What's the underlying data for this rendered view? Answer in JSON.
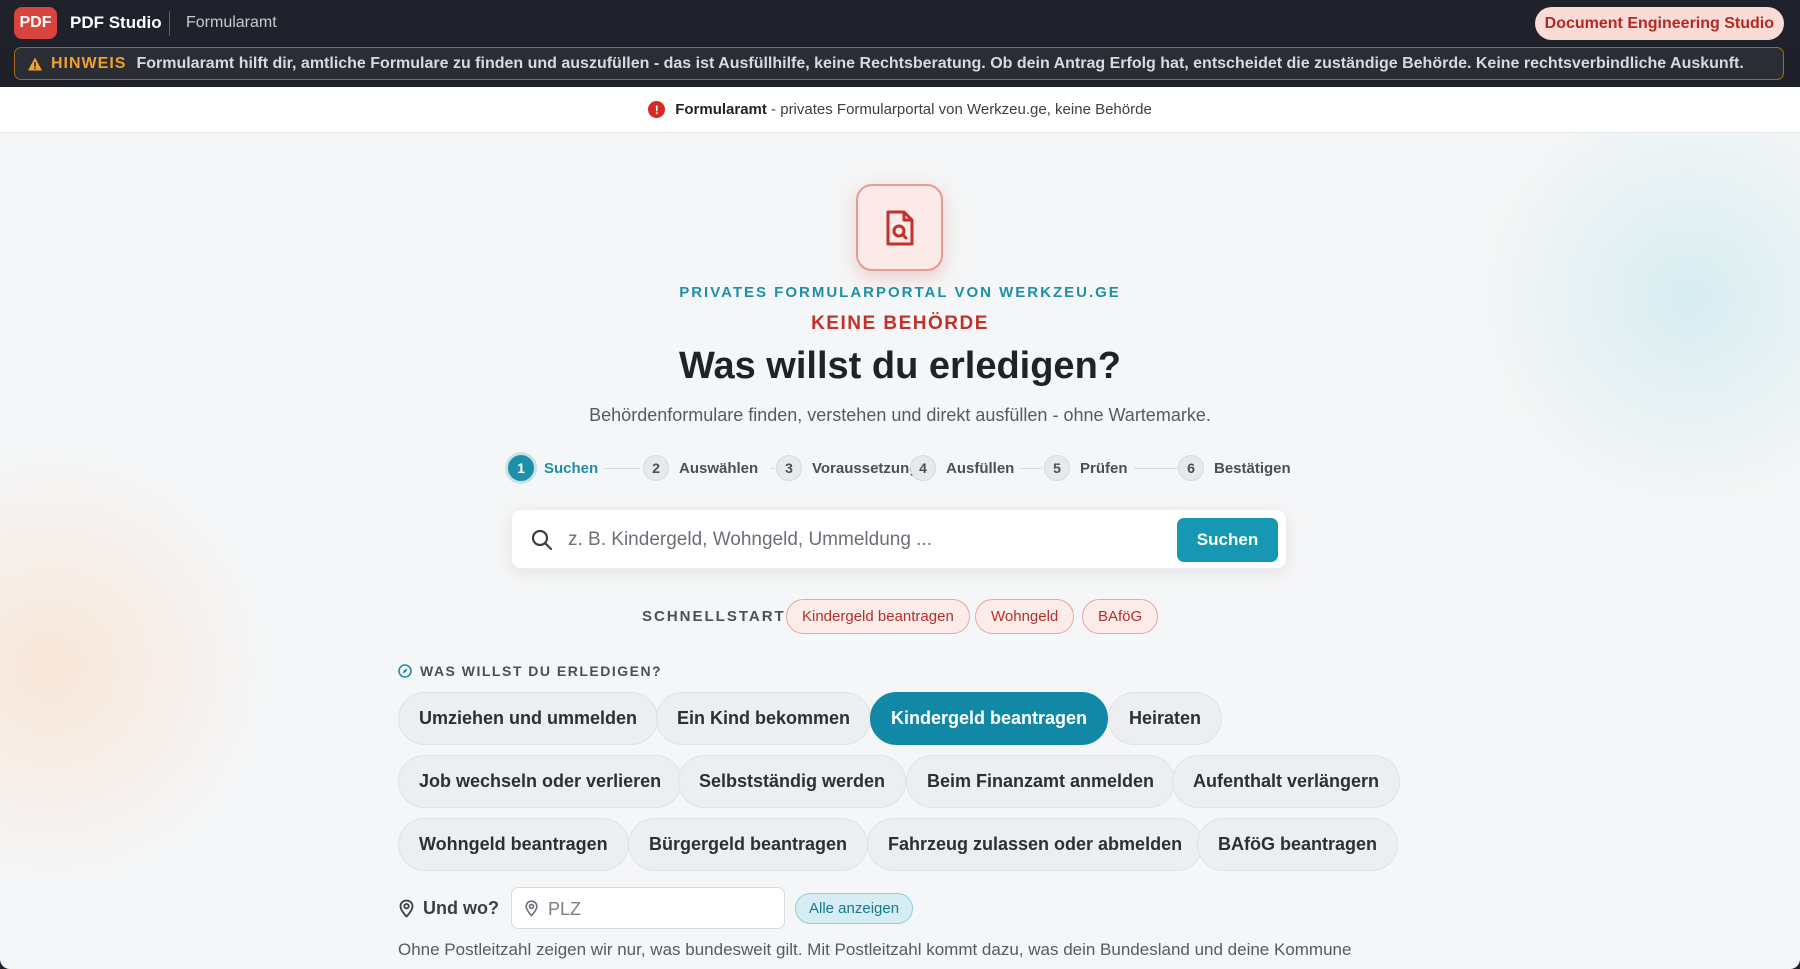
{
  "topbar": {
    "logo": "PDF",
    "app_name": "PDF Studio",
    "breadcrumb": "Formularamt",
    "brand_pill": "Document Engineering Studio"
  },
  "notice": {
    "label": "HINWEIS",
    "text": "Formularamt hilft dir, amtliche Formulare zu finden und auszufüllen - das ist Ausfüllhilfe, keine Rechtsberatung. Ob dein Antrag Erfolg hat, entscheidet die zuständige Behörde. Keine rechtsverbindliche Auskunft."
  },
  "info_strip": {
    "icon": "!",
    "strong": "Formularamt",
    "text": " - privates Formularportal von Werkzeu.ge, keine Behörde"
  },
  "hero": {
    "icon": "document-search-icon",
    "eyebrow": "PRIVATES FORMULARPORTAL VON WERKZEU.GE",
    "not_authority": "KEINE BEHÖRDE",
    "headline": "Was willst du erledigen?",
    "subline": "Behördenformulare finden, verstehen und direkt ausfüllen - ohne Wartemarke."
  },
  "steps": [
    {
      "num": "1",
      "label": "Suchen",
      "active": true
    },
    {
      "num": "2",
      "label": "Auswählen"
    },
    {
      "num": "3",
      "label": "Voraussetzungen"
    },
    {
      "num": "4",
      "label": "Ausfüllen"
    },
    {
      "num": "5",
      "label": "Prüfen"
    },
    {
      "num": "6",
      "label": "Bestätigen"
    }
  ],
  "search": {
    "placeholder": "z. B. Kindergeld, Wohngeld, Ummeldung ...",
    "button": "Suchen"
  },
  "quickstart": {
    "label": "SCHNELLSTART",
    "chips": [
      "Kindergeld beantragen",
      "Wohngeld",
      "BAföG"
    ]
  },
  "tasks": {
    "label": "WAS WILLST DU ERLEDIGEN?",
    "items": [
      "Umziehen und ummelden",
      "Ein Kind bekommen",
      "Kindergeld beantragen",
      "Heiraten",
      "Job wechseln oder verlieren",
      "Selbstständig werden",
      "Beim Finanzamt anmelden",
      "Aufenthalt verlängern",
      "Wohngeld beantragen",
      "Bürgergeld beantragen",
      "Fahrzeug zulassen oder abmelden",
      "BAföG beantragen"
    ],
    "selected": "Kindergeld beantragen"
  },
  "location": {
    "label": "Und wo?",
    "placeholder": "PLZ",
    "all_button": "Alle anzeigen"
  },
  "footnote": "Ohne Postleitzahl zeigen wir nur, was bundesweit gilt. Mit Postleitzahl kommt dazu, was dein Bundesland und deine Kommune",
  "colors": {
    "accent": "#1697b4",
    "brand_red": "#d9453e",
    "warning": "#f0a02e"
  }
}
